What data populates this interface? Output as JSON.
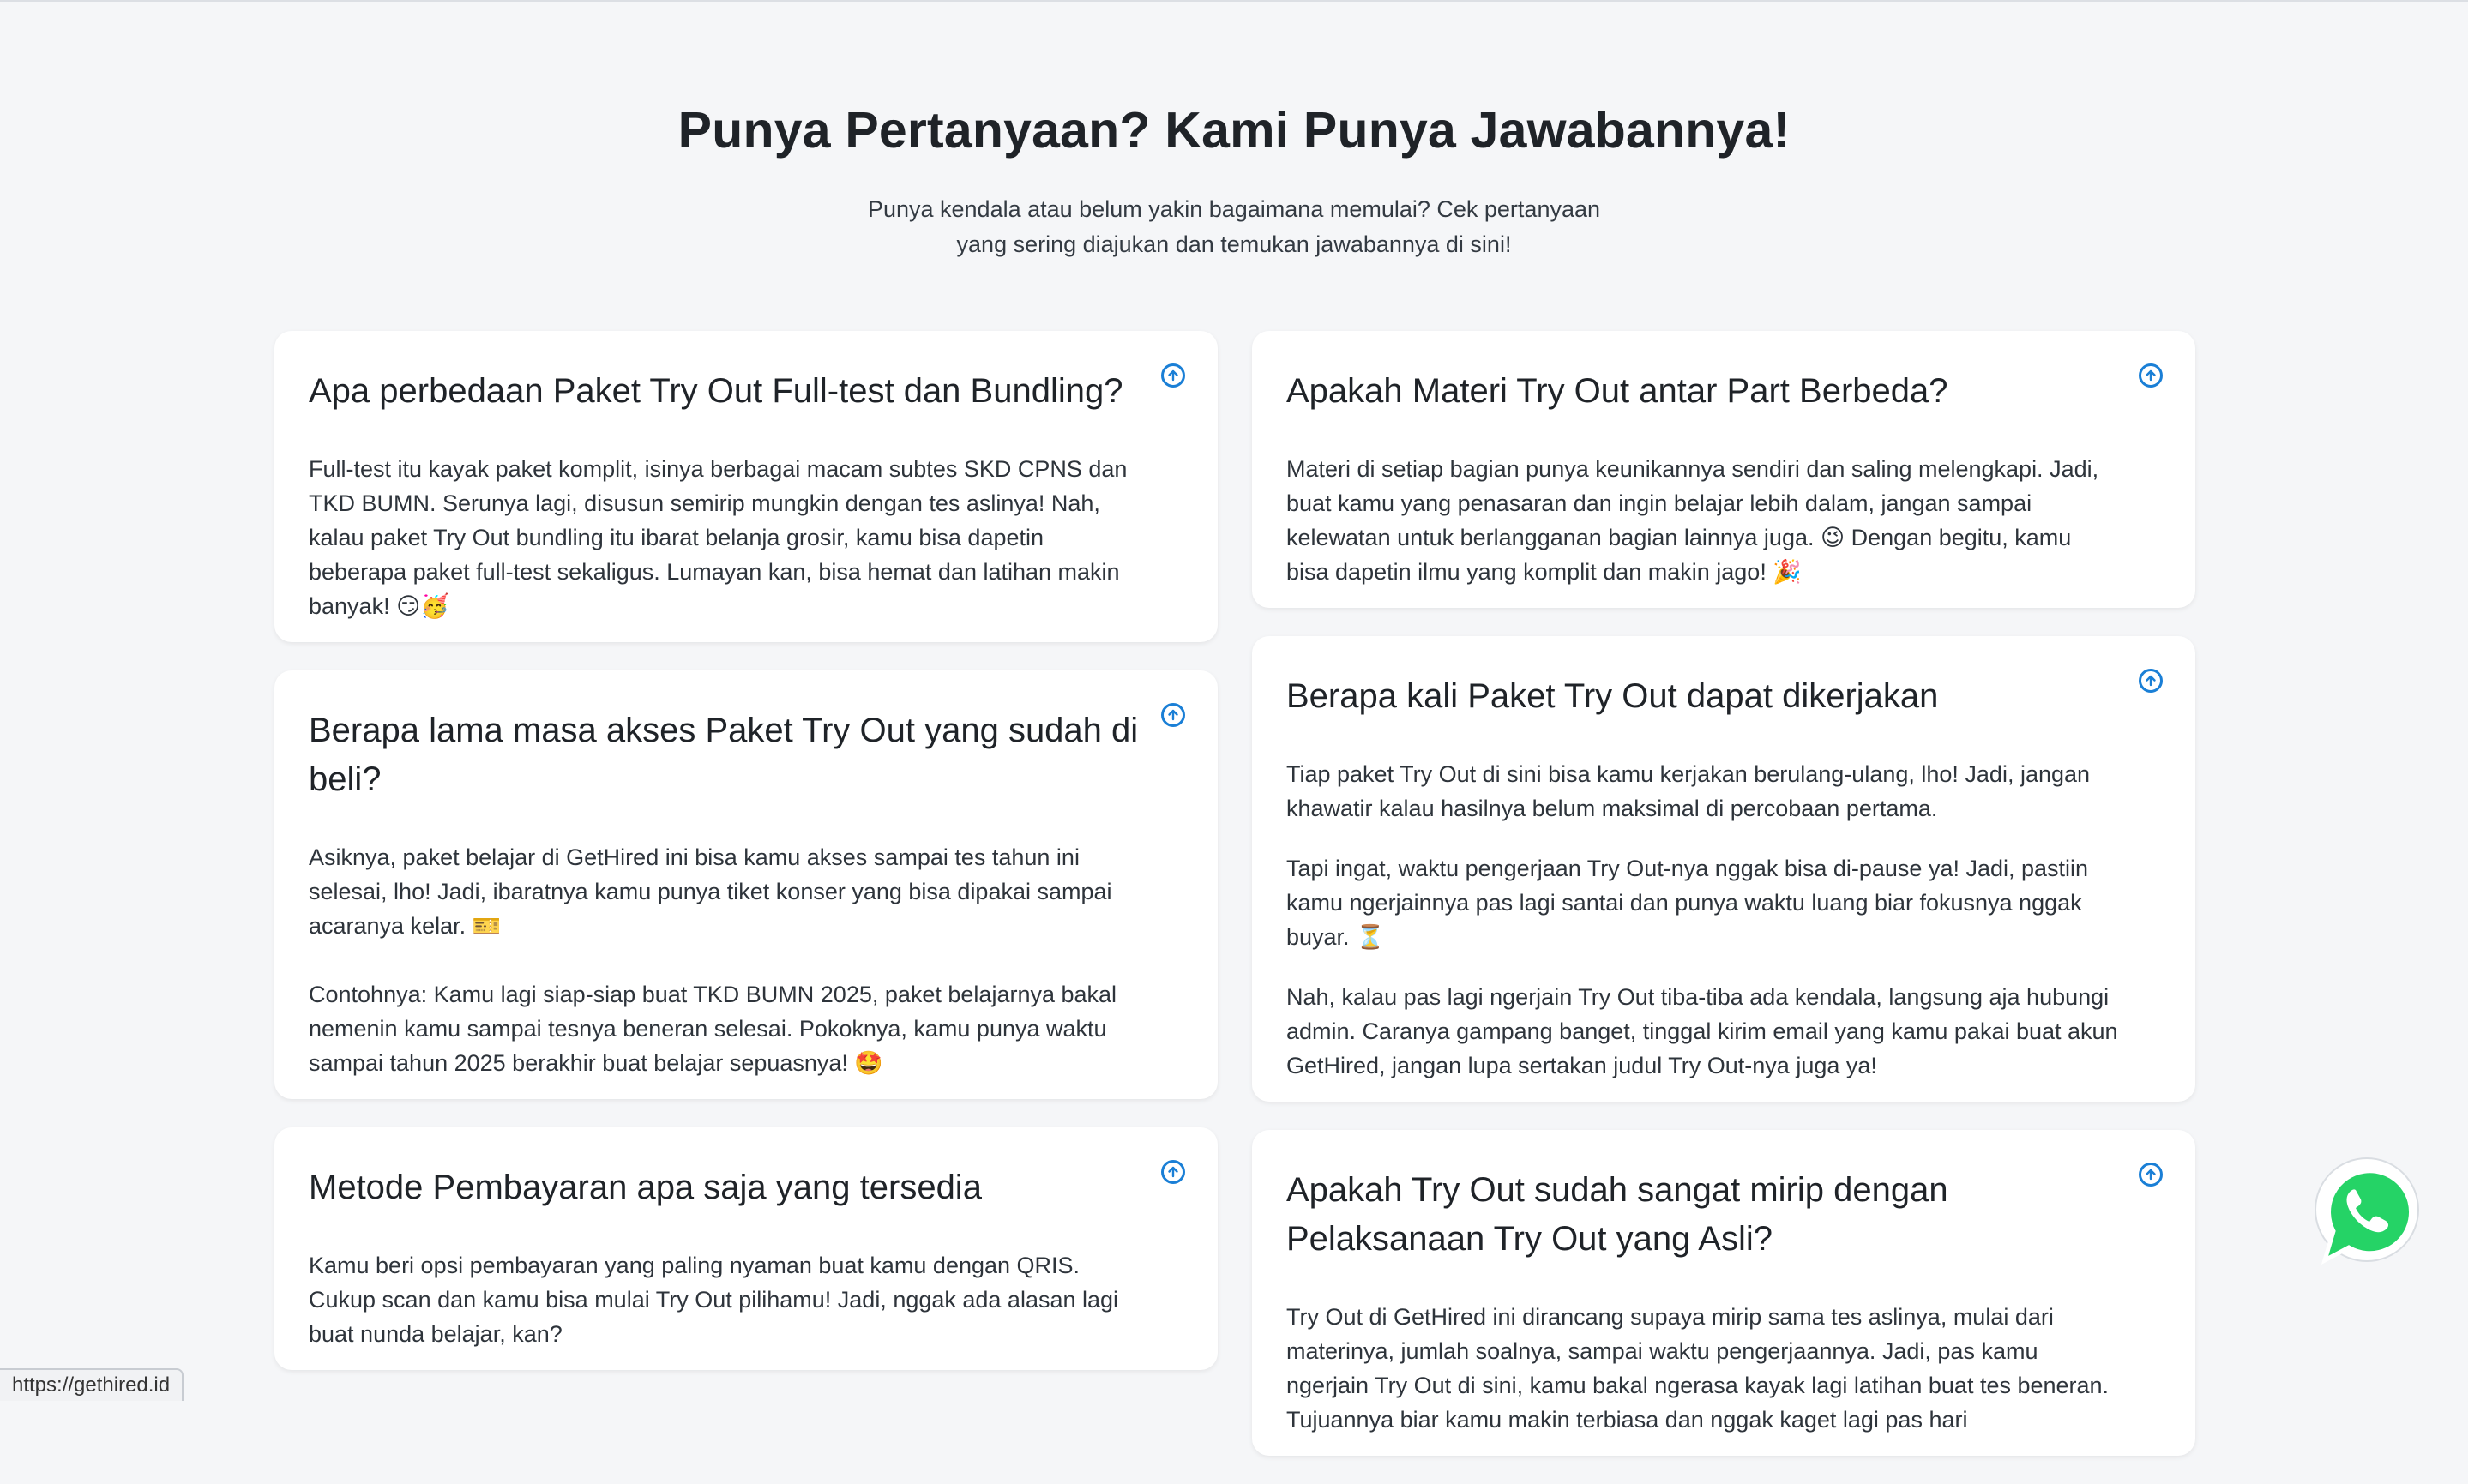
{
  "header": {
    "title": "Punya Pertanyaan? Kami Punya Jawabannya!",
    "subtitle_line1": "Punya kendala atau belum yakin bagaimana memulai? Cek pertanyaan",
    "subtitle_line2": "yang sering diajukan dan temukan jawabannya di sini!"
  },
  "faq_left": [
    {
      "question": "Apa perbedaan Paket Try Out Full-test dan Bundling?",
      "answer": [
        "Full-test itu kayak paket komplit, isinya berbagai macam subtes SKD CPNS dan TKD BUMN. Serunya lagi, disusun semirip mungkin dengan tes aslinya! Nah, kalau paket Try Out bundling itu ibarat belanja grosir, kamu bisa dapetin beberapa paket full-test sekaligus. Lumayan kan, bisa hemat dan latihan makin banyak! 😏🥳"
      ]
    },
    {
      "question": "Berapa lama masa akses Paket Try Out yang sudah di beli?",
      "answer": [
        "Asiknya, paket belajar di GetHired ini bisa kamu akses sampai tes tahun ini selesai, lho! Jadi, ibaratnya kamu punya tiket konser yang bisa dipakai sampai acaranya kelar. 🎫",
        "Contohnya: Kamu lagi siap-siap buat TKD BUMN 2025, paket belajarnya bakal nemenin kamu sampai tesnya beneran selesai. Pokoknya, kamu punya waktu sampai tahun 2025 berakhir  buat belajar sepuasnya! 🤩"
      ]
    },
    {
      "question": "Metode Pembayaran apa saja yang tersedia",
      "answer": [
        "Kamu beri opsi pembayaran yang paling nyaman buat kamu dengan QRIS. Cukup scan dan kamu bisa mulai Try Out pilihamu! Jadi, nggak ada alasan lagi buat nunda belajar, kan?"
      ]
    }
  ],
  "faq_right": [
    {
      "question": "Apakah Materi Try Out antar Part Berbeda?",
      "answer": [
        "Materi di setiap bagian punya keunikannya sendiri dan saling melengkapi. Jadi, buat kamu yang penasaran dan ingin belajar lebih dalam, jangan sampai kelewatan untuk berlangganan bagian lainnya juga. 😉 Dengan begitu, kamu bisa dapetin ilmu yang komplit dan makin jago! 🎉"
      ]
    },
    {
      "question": "Berapa kali Paket Try Out dapat dikerjakan",
      "answer": [
        "Tiap paket Try Out di sini bisa kamu kerjakan berulang-ulang, lho! Jadi, jangan khawatir kalau hasilnya belum maksimal di percobaan pertama.",
        "Tapi ingat, waktu pengerjaan Try Out-nya nggak bisa di-pause ya! Jadi, pastiin kamu ngerjainnya pas lagi santai dan punya waktu luang biar fokusnya nggak buyar. ⏳",
        "Nah, kalau pas lagi ngerjain Try Out tiba-tiba ada kendala, langsung aja hubungi admin. Caranya gampang banget, tinggal kirim email yang kamu pakai buat akun GetHired, jangan lupa sertakan judul Try Out-nya juga ya!"
      ]
    },
    {
      "question": "Apakah Try Out sudah sangat mirip dengan Pelaksanaan Try Out yang Asli?",
      "answer": [
        "Try Out di GetHired ini dirancang supaya mirip sama tes aslinya, mulai dari materinya, jumlah soalnya, sampai waktu pengerjaannya. Jadi, pas kamu ngerjain Try Out di sini, kamu bakal ngerasa kayak lagi latihan buat tes beneran. Tujuannya biar kamu makin terbiasa dan nggak kaget lagi pas hari"
      ]
    }
  ],
  "status_bar": {
    "url": "https://gethired.id"
  },
  "icons": {
    "toggle": "arrow-up-circle-icon",
    "whatsapp": "whatsapp-icon"
  },
  "colors": {
    "accent": "#1a7fd6",
    "whatsapp": "#25d366",
    "background": "#f5f6f8"
  }
}
